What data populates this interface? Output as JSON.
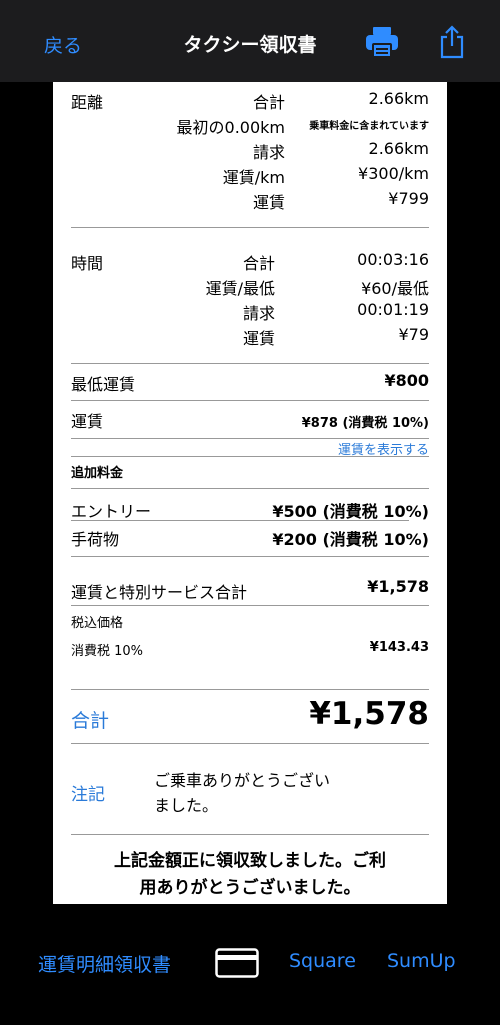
{
  "nav": {
    "back_label": "戻る",
    "title": "タクシー領収書",
    "print_icon": "printer-icon",
    "share_icon": "share-icon"
  },
  "distance": {
    "label": "距離",
    "total_label": "合計",
    "total_value": "2.66km",
    "initial_label": "最初の0.00km",
    "initial_value": "乗車料金に含まれています",
    "billed_label": "請求",
    "billed_value": "2.66km",
    "rate_label": "運賃/km",
    "rate_value": "¥300/km",
    "fare_label": "運賃",
    "fare_value": "¥799"
  },
  "time": {
    "label": "時間",
    "total_label": "合計",
    "total_value": "00:03:16",
    "rate_label": "運賃/最低",
    "rate_value": "¥60/最低",
    "billed_label": "請求",
    "billed_value": "00:01:19",
    "fare_label": "運賃",
    "fare_value": "¥79"
  },
  "minimum_fare": {
    "label": "最低運賃",
    "value": "¥800"
  },
  "fare": {
    "label": "運賃",
    "value": "¥878 (消費税 10%)",
    "show_fare_link": "運賃を表示する"
  },
  "extras": {
    "heading": "追加料金",
    "items": [
      {
        "label": "エントリー",
        "value": "¥500 (消費税 10%)"
      },
      {
        "label": "手荷物",
        "value": "¥200 (消費税 10%)"
      }
    ]
  },
  "summary": {
    "subtotal_label": "運賃と特別サービス合計",
    "subtotal_value": "¥1,578",
    "tax_included_label": "税込価格",
    "tax_label": "消費税 10%",
    "tax_value": "¥143.43"
  },
  "total": {
    "label": "合計",
    "value": "¥1,578"
  },
  "note": {
    "label": "注記",
    "text_line1": "ご乗車ありがとうござい",
    "text_line2": "ました。"
  },
  "footer": {
    "line1": "上記金額正に領収致しました。ご利",
    "line2": "用ありがとうございました。"
  },
  "bottom_bar": {
    "itemized_label": "運賃明細領収書",
    "card_icon": "credit-card-icon",
    "square_label": "Square",
    "sumup_label": "SumUp"
  },
  "colors": {
    "accent": "#2f8cff",
    "link": "#2a7ad8",
    "topbar": "#1c1c1e",
    "background": "#000000",
    "paper": "#ffffff"
  }
}
